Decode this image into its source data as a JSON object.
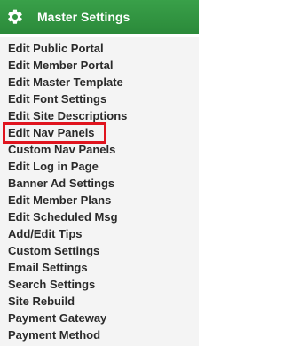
{
  "header": {
    "icon": "gear-icon",
    "title": "Master Settings",
    "background_color": "#339843"
  },
  "highlight": {
    "target": "Edit Nav Panels",
    "color": "#e0141e"
  },
  "menu": {
    "items": [
      {
        "label": "Edit Public Portal"
      },
      {
        "label": "Edit Member Portal"
      },
      {
        "label": "Edit Master Template"
      },
      {
        "label": "Edit Font Settings"
      },
      {
        "label": "Edit Site Descriptions"
      },
      {
        "label": "Edit Nav Panels"
      },
      {
        "label": "Custom Nav Panels"
      },
      {
        "label": "Edit Log in Page"
      },
      {
        "label": "Banner Ad Settings"
      },
      {
        "label": "Edit Member Plans"
      },
      {
        "label": "Edit Scheduled Msg"
      },
      {
        "label": "Add/Edit Tips"
      },
      {
        "label": "Custom Settings"
      },
      {
        "label": "Email Settings"
      },
      {
        "label": "Search Settings"
      },
      {
        "label": "Site Rebuild"
      },
      {
        "label": "Payment Gateway"
      },
      {
        "label": "Payment Method"
      }
    ]
  }
}
